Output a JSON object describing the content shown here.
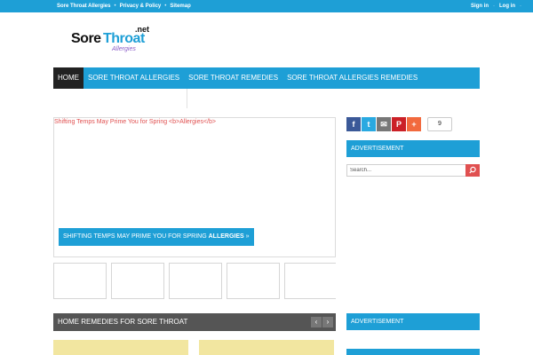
{
  "topbar": {
    "links": [
      "Sore Throat Allergies",
      "Privacy & Policy",
      "Sitemap"
    ],
    "separator": "•",
    "auth": {
      "signin": "Sign in",
      "login": "Log in",
      "separator": "·"
    }
  },
  "logo": {
    "net": ".net",
    "sore": "Sore",
    "throat": "Throat",
    "allergies": "Allergies"
  },
  "nav": {
    "items": [
      "Home",
      "Sore Throat Allergies",
      "Sore Throat Remedies",
      "Sore Throat Allergies Remedies"
    ]
  },
  "slider": {
    "alt_text": "Shifting Temps May Prime You for Spring <b>Allergies</b>",
    "caption_text": "SHIFTING TEMPS MAY PRIME YOU FOR SPRING ",
    "caption_bold": "ALLERGIES",
    "caption_suffix": " »"
  },
  "section": {
    "title": "Home Remedies for Sore Throat",
    "prev": "‹",
    "next": "›"
  },
  "share": {
    "facebook": "f",
    "twitter": "t",
    "email": "✉",
    "pinterest": "P",
    "more": "+",
    "count": "9",
    "colors": {
      "facebook": "#3b5998",
      "twitter": "#29a9e1",
      "email": "#777777",
      "pinterest": "#cb2027",
      "more": "#f26a3e"
    }
  },
  "sidebar": {
    "advertisement_1": "Advertisement",
    "search_placeholder": "Search...",
    "advertisement_2": "Advertisement"
  },
  "colors": {
    "accent": "#1e9fd6",
    "nav_active": "#222222",
    "section_bar": "#555555",
    "search_button": "#e05050",
    "card": "#f2e6a0"
  }
}
